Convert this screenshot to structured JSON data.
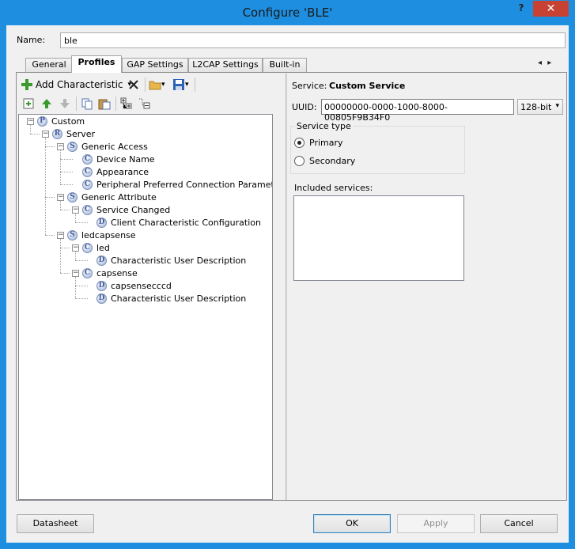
{
  "window": {
    "title": "Configure 'BLE'",
    "help_label": "?",
    "close_label": "✕"
  },
  "name_field": {
    "label": "Name:",
    "value": "ble"
  },
  "tabs": [
    {
      "label": "General"
    },
    {
      "label": "Profiles"
    },
    {
      "label": "GAP Settings"
    },
    {
      "label": "L2CAP Settings"
    },
    {
      "label": "Built-in"
    }
  ],
  "tab_scroll": {
    "left": "◂",
    "right": "▸"
  },
  "toolbar": {
    "add_characteristic_label": "Add Characteristic",
    "dropdown": "▾"
  },
  "tree": {
    "nodes": [
      {
        "badge": "P",
        "label": "Custom"
      },
      {
        "badge": "R",
        "label": "Server"
      },
      {
        "badge": "S",
        "label": "Generic Access"
      },
      {
        "badge": "C",
        "label": "Device Name"
      },
      {
        "badge": "C",
        "label": "Appearance"
      },
      {
        "badge": "C",
        "label": "Peripheral Preferred Connection Parameters"
      },
      {
        "badge": "S",
        "label": "Generic Attribute"
      },
      {
        "badge": "C",
        "label": "Service Changed"
      },
      {
        "badge": "D",
        "label": "Client Characteristic Configuration"
      },
      {
        "badge": "S",
        "label": "ledcapsense"
      },
      {
        "badge": "C",
        "label": "led"
      },
      {
        "badge": "D",
        "label": "Characteristic User Description"
      },
      {
        "badge": "C",
        "label": "capsense"
      },
      {
        "badge": "D",
        "label": "capsensecccd"
      },
      {
        "badge": "D",
        "label": "Characteristic User Description"
      }
    ],
    "expander": "−"
  },
  "details": {
    "service_label": "Service:",
    "service_name": "Custom Service",
    "uuid_label": "UUID:",
    "uuid_value": "00000000-0000-1000-8000-00805F9B34F0",
    "uuid_size": "128-bit",
    "service_type_title": "Service type",
    "primary_label": "Primary",
    "secondary_label": "Secondary",
    "included_services_label": "Included services:"
  },
  "buttons": {
    "datasheet": "Datasheet",
    "ok": "OK",
    "apply": "Apply",
    "cancel": "Cancel"
  },
  "colors": {
    "title_bar": "#1e8fe0",
    "close_button": "#c74233",
    "badge_fill": "#b8c6e4"
  }
}
